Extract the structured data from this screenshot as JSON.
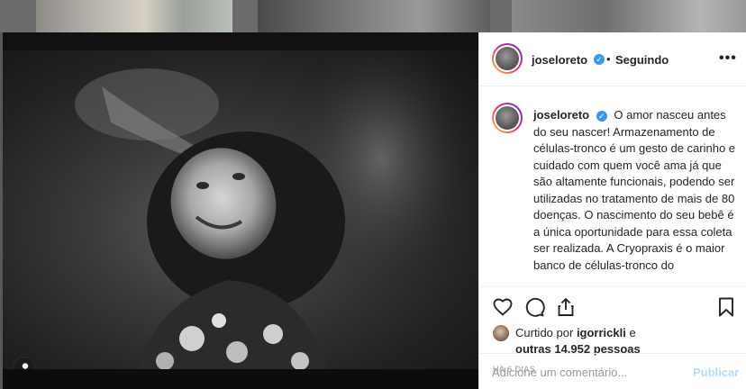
{
  "post": {
    "username": "joseloreto",
    "follow_status": "Seguindo",
    "separator": "•",
    "more_label": "•••",
    "caption_text": "O amor nasceu antes do seu nascer! Armazenamento de células-tronco é um gesto de carinho e cuidado com quem você ama já que são altamente funcionais, podendo ser utilizadas no tratamento de mais de 80 doenças. O nascimento do seu bebê é a única oportunidade para essa coleta ser realizada. A Cryopraxis é o maior banco de células-tronco do",
    "verified_mark": "✓",
    "likes": {
      "liked_by_prefix": "Curtido por",
      "liked_by_user": "igorrickli",
      "conjunction": "e",
      "others_text": "outras 14.952 pessoas"
    },
    "timestamp": "HÁ 6 DIAS",
    "comment_placeholder": "Adicione um comentário...",
    "post_button": "Publicar"
  },
  "colors": {
    "verified": "#3897f0",
    "text": "#262626",
    "muted": "#999999",
    "post_button_disabled": "#b3dbff"
  },
  "icons": {
    "like": "heart-icon",
    "comment": "comment-icon",
    "share": "share-icon",
    "save": "bookmark-icon",
    "user_tag": "user-tag-icon",
    "more": "more-options-icon"
  }
}
